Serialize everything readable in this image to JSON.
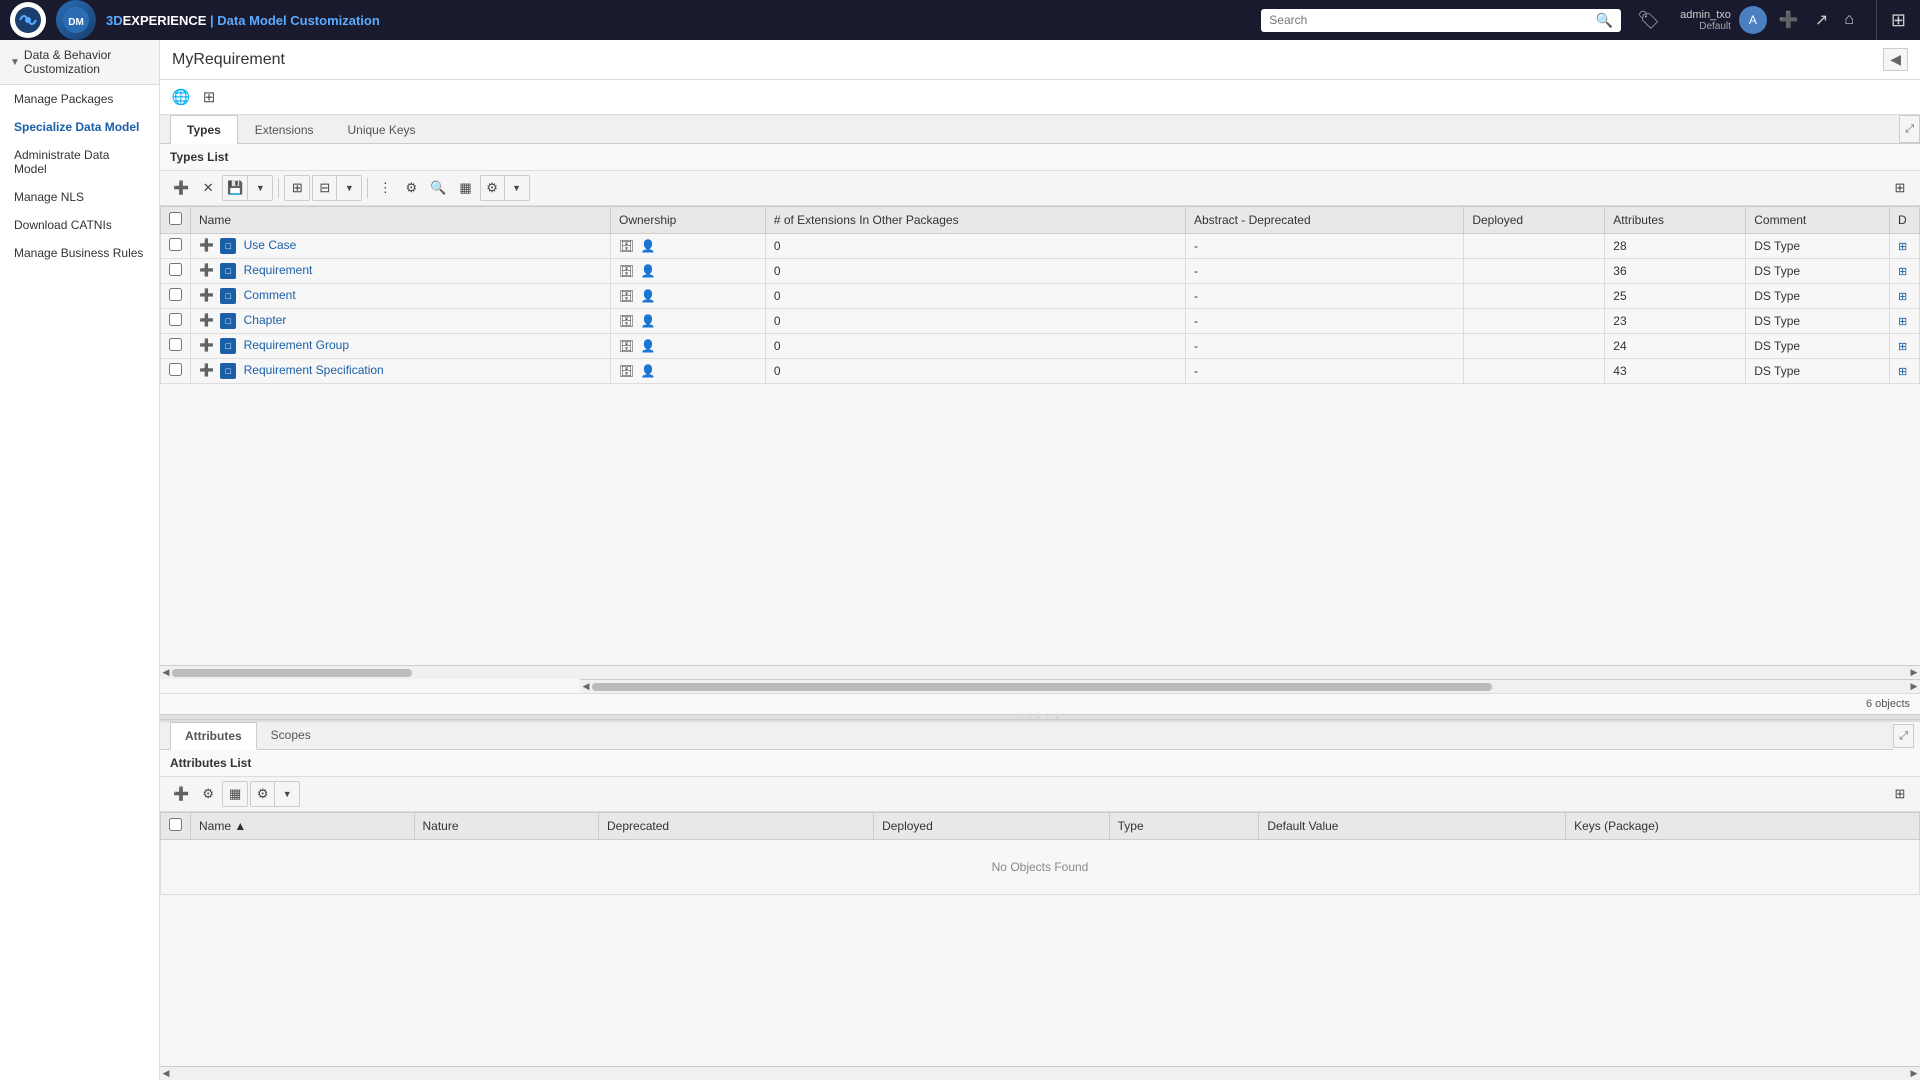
{
  "topbar": {
    "title": "3DEXPERIENCE | Data  Model Customization",
    "title_3dx": "3D",
    "title_exp": "EXPERIENCE",
    "title_rest": " | Data  Model Customization",
    "search_placeholder": "Search",
    "user": {
      "name": "admin_txo",
      "profile": "Default"
    }
  },
  "sidebar": {
    "header": "Data & Behavior Customization",
    "items": [
      {
        "label": "Manage Packages",
        "active": false
      },
      {
        "label": "Specialize Data Model",
        "active": true
      },
      {
        "label": "Administrate Data Model",
        "active": false
      },
      {
        "label": "Manage NLS",
        "active": false
      },
      {
        "label": "Download CATNIs",
        "active": false
      },
      {
        "label": "Manage Business Rules",
        "active": false
      }
    ]
  },
  "content": {
    "title": "MyRequirement",
    "tabs": [
      {
        "label": "Types",
        "active": true
      },
      {
        "label": "Extensions",
        "active": false
      },
      {
        "label": "Unique Keys",
        "active": false
      }
    ],
    "types_list": {
      "title": "Types List",
      "columns": [
        {
          "label": "Name"
        },
        {
          "label": "Ownership"
        },
        {
          "label": "# of Extensions In Other Packages"
        },
        {
          "label": "Abstract - Deprecated"
        },
        {
          "label": "Deployed"
        },
        {
          "label": "Attributes"
        },
        {
          "label": "Comment"
        },
        {
          "label": "D"
        }
      ],
      "rows": [
        {
          "name": "Use Case",
          "ownership": "",
          "extensions": "0",
          "abstract_dep": "-",
          "deployed": "",
          "attributes": "28",
          "comment": "DS Type"
        },
        {
          "name": "Requirement",
          "ownership": "",
          "extensions": "0",
          "abstract_dep": "-",
          "deployed": "",
          "attributes": "36",
          "comment": "DS Type"
        },
        {
          "name": "Comment",
          "ownership": "",
          "extensions": "0",
          "abstract_dep": "-",
          "deployed": "",
          "attributes": "25",
          "comment": "DS Type"
        },
        {
          "name": "Chapter",
          "ownership": "",
          "extensions": "0",
          "abstract_dep": "-",
          "deployed": "",
          "attributes": "23",
          "comment": "DS Type"
        },
        {
          "name": "Requirement Group",
          "ownership": "",
          "extensions": "0",
          "abstract_dep": "-",
          "deployed": "",
          "attributes": "24",
          "comment": "DS Type"
        },
        {
          "name": "Requirement Specification",
          "ownership": "",
          "extensions": "0",
          "abstract_dep": "-",
          "deployed": "",
          "attributes": "43",
          "comment": "DS Type"
        }
      ],
      "count": "6 objects"
    },
    "attributes": {
      "title": "Attributes List",
      "tabs": [
        {
          "label": "Attributes",
          "active": true
        },
        {
          "label": "Scopes",
          "active": false
        }
      ],
      "columns": [
        {
          "label": "Name ▲"
        },
        {
          "label": "Nature"
        },
        {
          "label": "Deprecated"
        },
        {
          "label": "Deployed"
        },
        {
          "label": "Type"
        },
        {
          "label": "Default Value"
        },
        {
          "label": "Keys (Package)"
        }
      ],
      "no_objects": "No Objects Found"
    }
  }
}
